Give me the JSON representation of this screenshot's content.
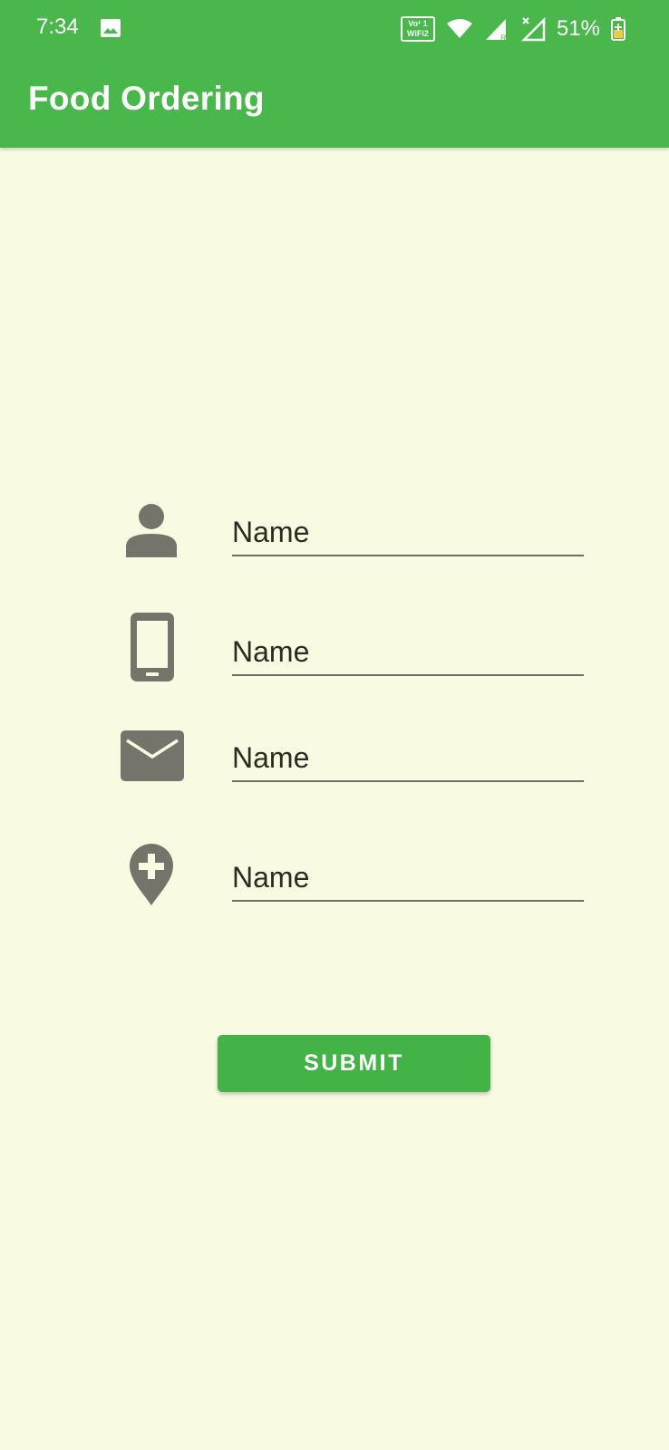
{
  "status_bar": {
    "time": "7:34",
    "volte_line1": "Vo¹ 1",
    "volte_line2": "WiFi2",
    "battery_percent": "51%",
    "icons": [
      "image-icon",
      "volte-wifi-icon",
      "wifi-icon",
      "signal-roaming-icon",
      "signal-no-service-icon",
      "battery-charging-icon"
    ]
  },
  "app_bar": {
    "title": "Food Ordering"
  },
  "form": {
    "fields": [
      {
        "icon": "person-icon",
        "placeholder": "Name",
        "value": ""
      },
      {
        "icon": "phone-icon",
        "placeholder": "Name",
        "value": ""
      },
      {
        "icon": "mail-icon",
        "placeholder": "Name",
        "value": ""
      },
      {
        "icon": "add-location-icon",
        "placeholder": "Name",
        "value": ""
      }
    ],
    "submit_label": "SUBMIT"
  },
  "colors": {
    "primary": "#49B74C",
    "background": "#F8FAE1",
    "icon": "#74746A",
    "button": "#43B347",
    "text": "#2B2B24"
  }
}
